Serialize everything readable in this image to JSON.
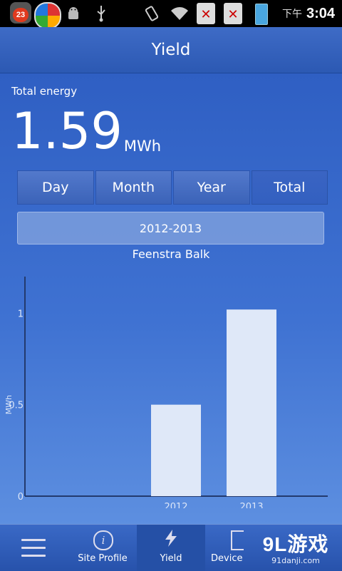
{
  "status_bar": {
    "notification_count": "23",
    "time_prefix": "下午",
    "time": "3:04"
  },
  "header": {
    "title": "Yield"
  },
  "energy": {
    "label": "Total energy",
    "value": "1.59",
    "unit": "MWh"
  },
  "tabs": [
    {
      "label": "Day",
      "active": false
    },
    {
      "label": "Month",
      "active": false
    },
    {
      "label": "Year",
      "active": false
    },
    {
      "label": "Total",
      "active": true
    }
  ],
  "period": {
    "label": "2012-2013"
  },
  "site": {
    "name": "Feenstra Balk"
  },
  "chart_data": {
    "type": "bar",
    "categories": [
      "2012",
      "2013"
    ],
    "values": [
      0.5,
      1.02
    ],
    "ylabel": "MWh",
    "ylim": [
      0,
      1.2
    ],
    "yticks": [
      "0",
      "0.5",
      "1"
    ],
    "grid": false,
    "bar_color": "#dfe8f8"
  },
  "bottom_nav": {
    "items": [
      {
        "label": "",
        "icon": "menu-icon"
      },
      {
        "label": "Site Profile",
        "icon": "info-icon"
      },
      {
        "label": "Yield",
        "icon": "bolt-icon",
        "active": true
      },
      {
        "label": "Device",
        "icon": "device-icon"
      }
    ]
  },
  "watermark": {
    "big": "9L游戏",
    "small": "91danji.com"
  },
  "colors": {
    "background": "#2f62c4",
    "accent": "#ffffff"
  }
}
